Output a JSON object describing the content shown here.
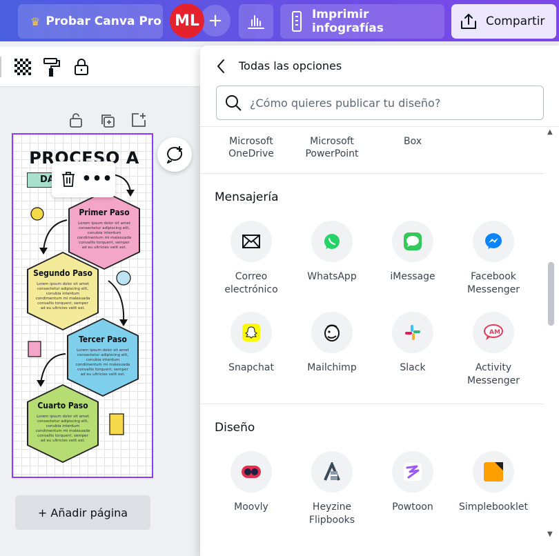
{
  "topbar": {
    "pro_label": "Probar Canva Pro",
    "avatar_initials": "ML",
    "add_collab": "+",
    "print_label": "Imprimir infografías",
    "share_label": "Compartir"
  },
  "canvas": {
    "title": "PROCESO A",
    "subtitle": "DA",
    "steps": [
      {
        "title": "Primer Paso",
        "text": "Lorem ipsum dolor sit amet consectetur adipiscing elit, conubia interdum condimentum mi malesuada convallis torquent, semper ad eu ultricies velit est.",
        "color": "#f4a6c8"
      },
      {
        "title": "Segundo Paso",
        "text": "Lorem ipsum dolor sit amet consectetur adipiscing elit, conubia interdum condimentum mi malesuada convallis torquent, semper ad eu ultricies velit est.",
        "color": "#f4eb9a"
      },
      {
        "title": "Tercer Paso",
        "text": "Lorem ipsum dolor sit amet consectetur adipiscing elit, conubia interdum condimentum mi malesuada convallis torquent, semper ad eu ultricies velit est.",
        "color": "#7fd0ec"
      },
      {
        "title": "Cuarto Paso",
        "text": "Lorem ipsum dolor sit amet consectetur adipiscing elit, conubia interdum condimentum mi malesuada convallis torquent, semper ad eu ultricies velit est.",
        "color": "#b5dd73"
      }
    ],
    "add_page_label": "+ Añadir página"
  },
  "panel": {
    "title": "Todas las opciones",
    "search_placeholder": "¿Cómo quieres publicar tu diseño?",
    "storage": [
      {
        "label": "Microsoft OneDrive"
      },
      {
        "label": "Microsoft PowerPoint"
      },
      {
        "label": "Box"
      }
    ],
    "messaging_title": "Mensajería",
    "messaging": [
      {
        "label": "Correo electrónico",
        "icon": "mail-icon"
      },
      {
        "label": "WhatsApp",
        "icon": "whatsapp-icon"
      },
      {
        "label": "iMessage",
        "icon": "imessage-icon"
      },
      {
        "label": "Facebook Messenger",
        "icon": "messenger-icon"
      },
      {
        "label": "Snapchat",
        "icon": "snapchat-icon"
      },
      {
        "label": "Mailchimp",
        "icon": "mailchimp-icon"
      },
      {
        "label": "Slack",
        "icon": "slack-icon"
      },
      {
        "label": "Activity Messenger",
        "icon": "activity-messenger-icon"
      }
    ],
    "design_title": "Diseño",
    "design": [
      {
        "label": "Moovly",
        "icon": "moovly-icon"
      },
      {
        "label": "Heyzine Flipbooks",
        "icon": "heyzine-icon"
      },
      {
        "label": "Powtoon",
        "icon": "powtoon-icon"
      },
      {
        "label": "Simplebooklet",
        "icon": "simplebooklet-icon"
      }
    ]
  },
  "colors": {
    "accent": "#8b3dff",
    "whatsapp": "#25d366",
    "imessage": "#34c759",
    "messenger": "#0a84ff",
    "snapchat": "#fffc00"
  }
}
